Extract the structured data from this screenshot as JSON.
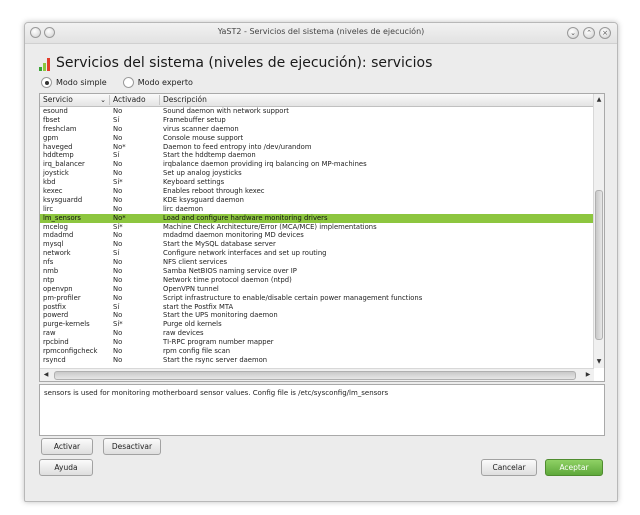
{
  "window": {
    "title": "YaST2 - Servicios del sistema (niveles de ejecución)"
  },
  "header": {
    "title": "Servicios del sistema (niveles de ejecución): servicios",
    "icon_colors": [
      "#3aa335",
      "#8dc63f",
      "#e23c2a"
    ]
  },
  "modes": {
    "simple": {
      "label": "Modo simple",
      "selected": true
    },
    "expert": {
      "label": "Modo experto",
      "selected": false
    }
  },
  "table": {
    "columns": [
      "Servicio",
      "Activado",
      "Descripción"
    ],
    "selected_index": 12,
    "rows": [
      [
        "esound",
        "No",
        "Sound daemon with network support"
      ],
      [
        "fbset",
        "Sí",
        "Framebuffer setup"
      ],
      [
        "freshclam",
        "No",
        "virus scanner daemon"
      ],
      [
        "gpm",
        "No",
        "Console mouse support"
      ],
      [
        "haveged",
        "No*",
        "Daemon to feed entropy into /dev/urandom"
      ],
      [
        "hddtemp",
        "Sí",
        "Start the hddtemp daemon"
      ],
      [
        "irq_balancer",
        "No",
        "irqbalance daemon providing irq balancing on MP-machines"
      ],
      [
        "joystick",
        "No",
        "Set up analog joysticks"
      ],
      [
        "kbd",
        "Sí*",
        "Keyboard settings"
      ],
      [
        "kexec",
        "No",
        "Enables reboot through kexec"
      ],
      [
        "ksysguardd",
        "No",
        "KDE ksysguard daemon"
      ],
      [
        "lirc",
        "No",
        "lirc daemon"
      ],
      [
        "lm_sensors",
        "No*",
        "Load and configure hardware monitoring drivers"
      ],
      [
        "mcelog",
        "Sí*",
        "Machine Check Architecture/Error (MCA/MCE) implementations"
      ],
      [
        "mdadmd",
        "No",
        "mdadmd daemon monitoring MD devices"
      ],
      [
        "mysql",
        "No",
        "Start the MySQL database server"
      ],
      [
        "network",
        "Sí",
        "Configure network interfaces and set up routing"
      ],
      [
        "nfs",
        "No",
        "NFS client services"
      ],
      [
        "nmb",
        "No",
        "Samba NetBIOS naming service over IP"
      ],
      [
        "ntp",
        "No",
        "Network time protocol daemon (ntpd)"
      ],
      [
        "openvpn",
        "No",
        "OpenVPN tunnel"
      ],
      [
        "pm-profiler",
        "No",
        "Script infrastructure to enable/disable certain power management functions"
      ],
      [
        "postfix",
        "Sí",
        "start the Postfix MTA"
      ],
      [
        "powerd",
        "No",
        "Start the UPS monitoring daemon"
      ],
      [
        "purge-kernels",
        "Sí*",
        "Purge old kernels"
      ],
      [
        "raw",
        "No",
        "raw devices"
      ],
      [
        "rpcbind",
        "No",
        "TI-RPC program number mapper"
      ],
      [
        "rpmconfigcheck",
        "No",
        "rpm config file scan"
      ],
      [
        "rsyncd",
        "No",
        "Start the rsync server daemon"
      ]
    ]
  },
  "description": "sensors is used for monitoring motherboard sensor values. Config file is /etc/sysconfig/lm_sensors",
  "buttons": {
    "activate": "Activar",
    "deactivate": "Desactivar",
    "help": "Ayuda",
    "cancel": "Cancelar",
    "accept": "Aceptar"
  }
}
